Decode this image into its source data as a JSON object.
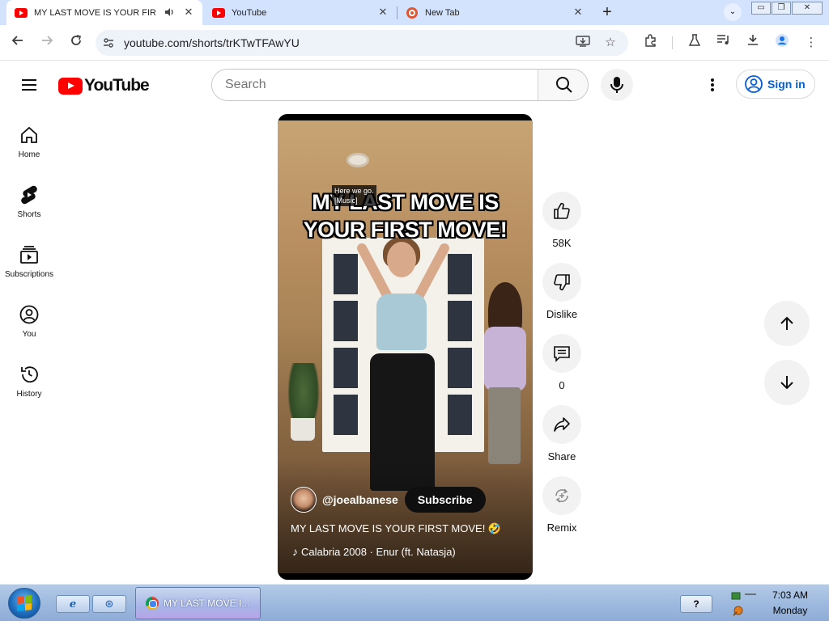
{
  "browser": {
    "tabs": [
      {
        "title": "MY LAST MOVE IS YOUR FIRS",
        "favicon": "youtube-icon",
        "audio": true,
        "active": true
      },
      {
        "title": "YouTube",
        "favicon": "youtube-icon",
        "active": false
      },
      {
        "title": "New Tab",
        "favicon": "duckduckgo-icon",
        "active": false
      }
    ],
    "url": "youtube.com/shorts/trKTwTFAwYU"
  },
  "masthead": {
    "logo_text": "YouTube",
    "search_placeholder": "Search",
    "signin_label": "Sign in"
  },
  "guide": [
    {
      "label": "Home",
      "icon": "home-icon"
    },
    {
      "label": "Shorts",
      "icon": "shorts-icon"
    },
    {
      "label": "Subscriptions",
      "icon": "subscriptions-icon"
    },
    {
      "label": "You",
      "icon": "you-icon"
    },
    {
      "label": "History",
      "icon": "history-icon"
    }
  ],
  "short": {
    "caption_line1": "Here we go.",
    "caption_line2": "[Music]",
    "overlay_line1": "MY LAST MOVE IS",
    "overlay_line2": "YOUR FIRST MOVE!",
    "channel_handle": "@joealbanese",
    "subscribe_label": "Subscribe",
    "description": "MY LAST MOVE IS YOUR FIRST MOVE! 🤣",
    "music": "Calabria 2008 · Enur (ft. Natasja)"
  },
  "actions": {
    "like_count": "58K",
    "dislike_label": "Dislike",
    "comment_count": "0",
    "share_label": "Share",
    "remix_label": "Remix"
  },
  "taskbar": {
    "window_title": "MY LAST MOVE I...",
    "help_label": "?",
    "time": "7:03 AM",
    "day": "Monday"
  },
  "colors": {
    "youtube_red": "#ff0000",
    "link_blue": "#065fd4",
    "tab_strip": "#d3e3fd"
  }
}
